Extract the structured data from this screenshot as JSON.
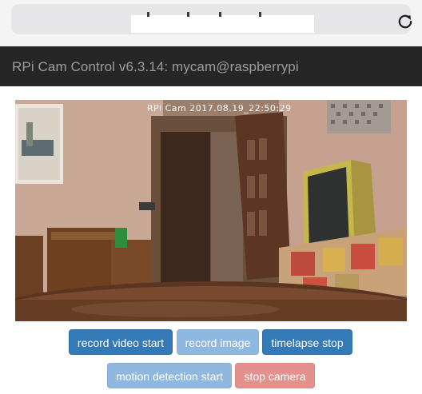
{
  "browser": {
    "reload_icon": "reload-icon"
  },
  "header": {
    "title": "RPi Cam Control v6.3.14: mycam@raspberrypi"
  },
  "preview": {
    "osd_text": "RPi Cam 2017.08.19_22:50:29"
  },
  "buttons": {
    "record_video": "record video start",
    "record_image": "record image",
    "timelapse": "timelapse stop",
    "motion_detection": "motion detection start",
    "stop_camera": "stop camera"
  },
  "colors": {
    "header_bg": "#262626",
    "header_text": "#9d9d9d",
    "primary": "#337ab7",
    "primary_faded": "#8fb8e0",
    "danger_faded": "#e4918e"
  }
}
